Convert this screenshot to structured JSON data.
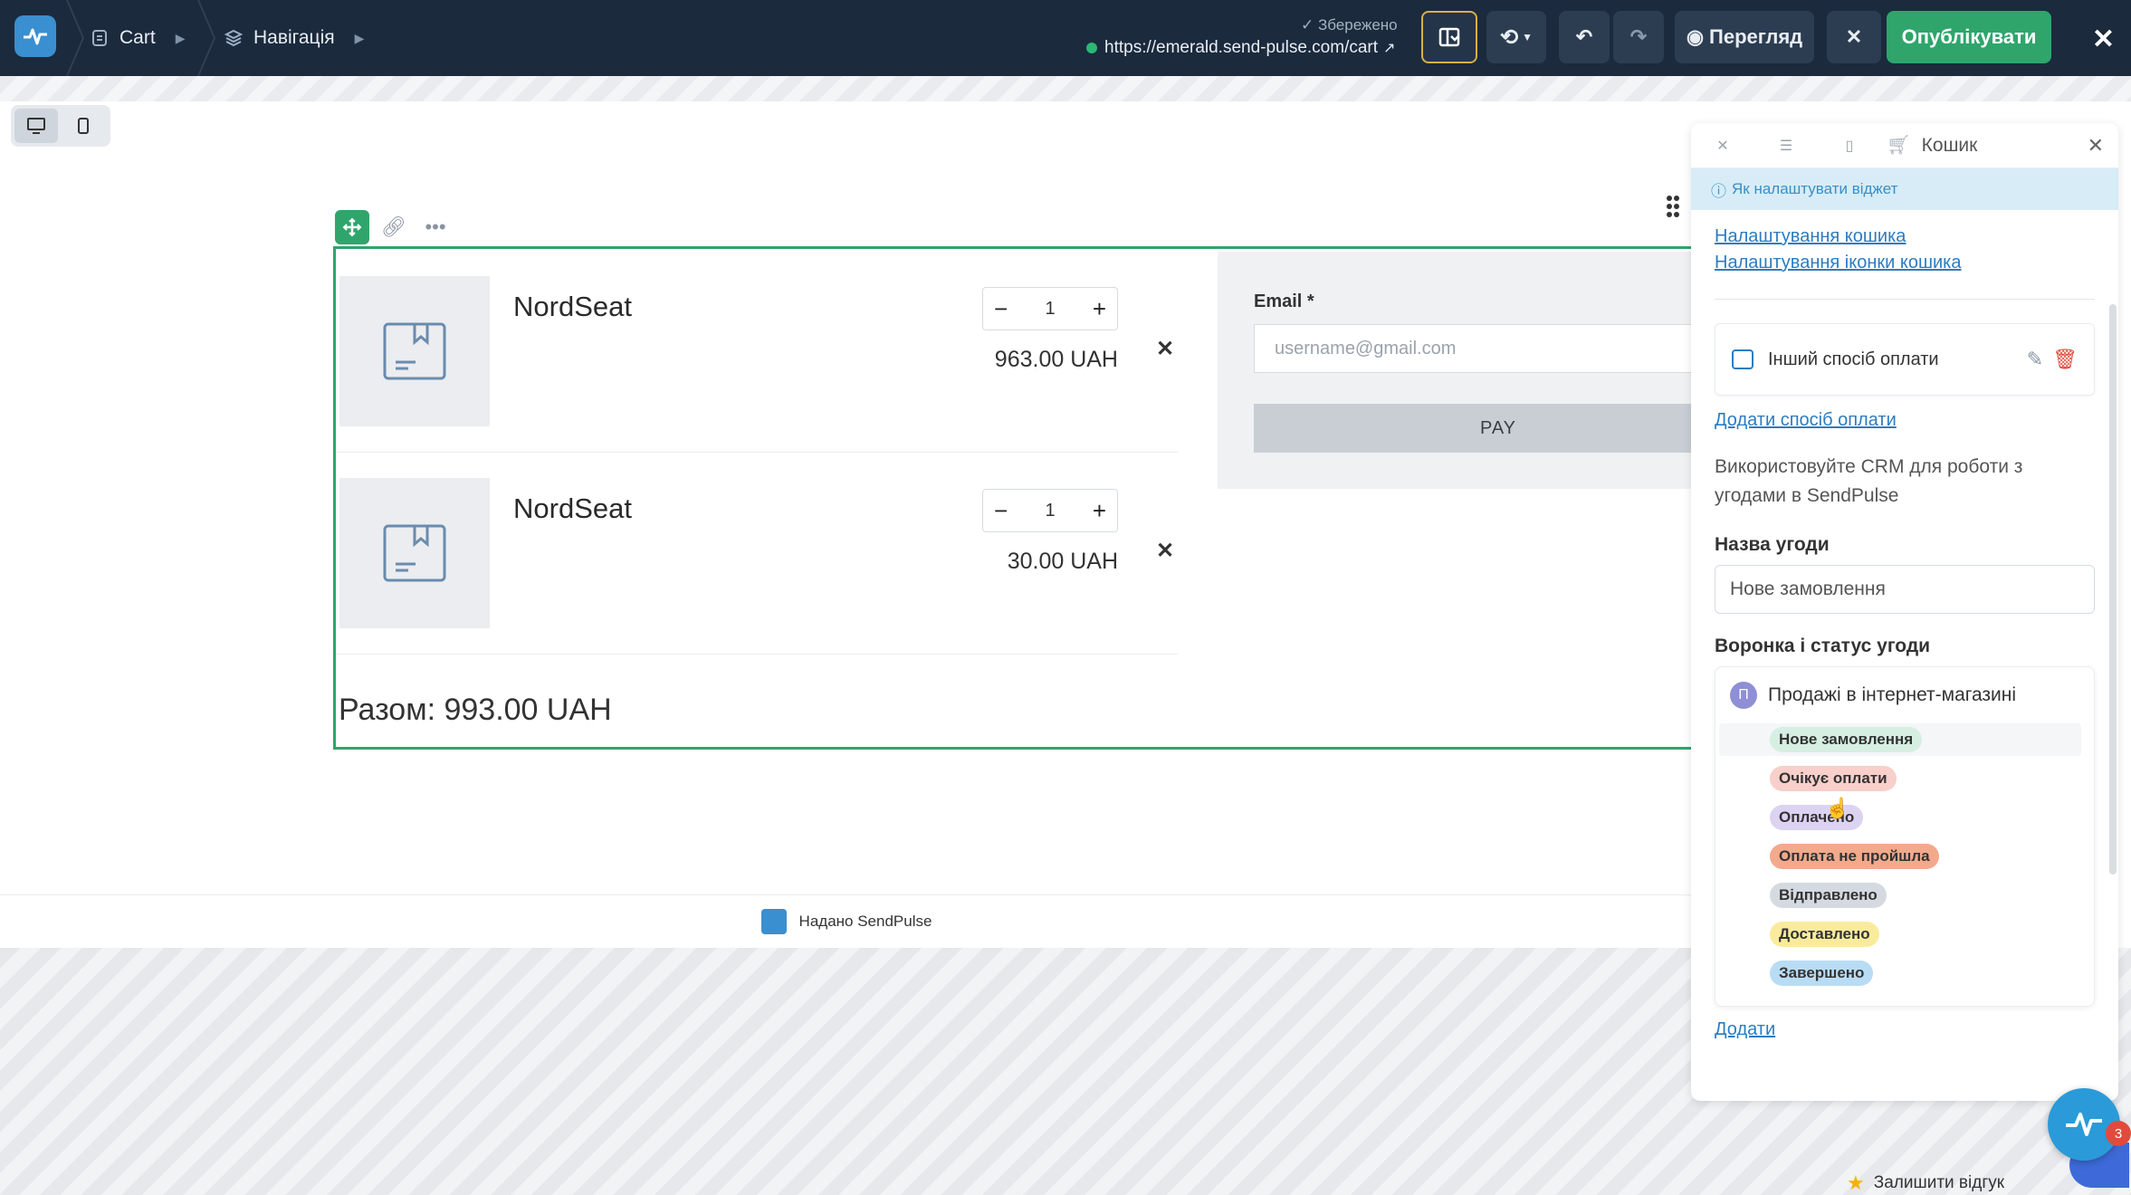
{
  "topbar": {
    "crumbs": [
      "Cart",
      "Навігація"
    ],
    "saved": "✓ Збережено",
    "url": "https://emerald.send-pulse.com/cart",
    "preview_label": "Перегляд",
    "publish_label": "Опублікувати"
  },
  "cart": {
    "items": [
      {
        "name": "NordSeat",
        "qty": "1",
        "price": "963.00 UAH"
      },
      {
        "name": "NordSeat",
        "qty": "1",
        "price": "30.00 UAH"
      }
    ],
    "total": "Разом: 993.00 UAH",
    "email_label": "Email *",
    "email_placeholder": "username@gmail.com",
    "pay_label": "PAY"
  },
  "footer": {
    "text": "Надано SendPulse"
  },
  "panel": {
    "title": "Кошик",
    "help": "Як налаштувати віджет",
    "links": [
      "Налаштування кошика",
      "Налаштування іконки кошика"
    ],
    "payment_method": "Інший спосіб оплати",
    "add_payment": "Додати спосіб оплати",
    "crm_text": "Використовуйте CRM для роботи з угодами в SendPulse",
    "deal_name_label": "Назва угоди",
    "deal_name_value": "Нове замовлення",
    "funnel_label": "Воронка і статус угоди",
    "funnel_avatar": "П",
    "funnel_name": "Продажі в інтернет-магазині",
    "statuses": [
      {
        "label": "Нове замовлення",
        "color": "#d6efe2"
      },
      {
        "label": "Очікує оплати",
        "color": "#f8cfca"
      },
      {
        "label": "Оплачено",
        "color": "#dcd3f3"
      },
      {
        "label": "Оплата не пройшла",
        "color": "#f3a98c"
      },
      {
        "label": "Відправлено",
        "color": "#d5dae0"
      },
      {
        "label": "Доставлено",
        "color": "#faeb9c"
      },
      {
        "label": "Завершено",
        "color": "#b9dcf5"
      }
    ],
    "add_label": "Додати"
  },
  "feedback": "Залишити відгук",
  "chat_badge": "3",
  "colors": {
    "accent": "#2fa56c",
    "topbar": "#1b2a3d",
    "link": "#2c7cc0"
  }
}
